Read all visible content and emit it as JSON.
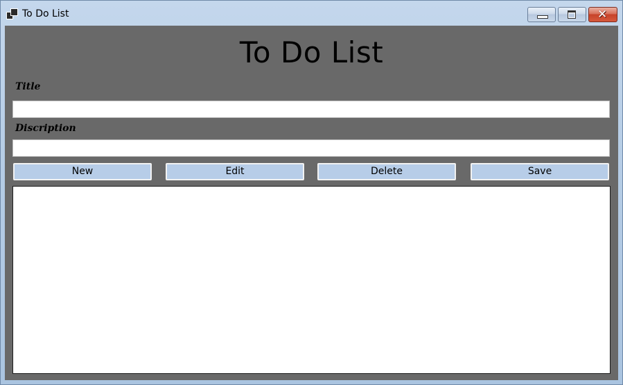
{
  "window": {
    "title": "To Do List",
    "icon": "app-icon",
    "controls": [
      "minimize-icon",
      "maximize-icon",
      "close-icon"
    ],
    "close_glyph": "✕"
  },
  "main": {
    "heading": "To Do List",
    "title_label": "Title",
    "title_value": "",
    "description_label": "Discription",
    "description_value": "",
    "buttons": {
      "new": "New",
      "edit": "Edit",
      "delete": "Delete",
      "save": "Save"
    },
    "items": []
  },
  "colors": {
    "client_background": "#696969",
    "button_background": "#b7cde8",
    "list_background": "#ffffff"
  }
}
